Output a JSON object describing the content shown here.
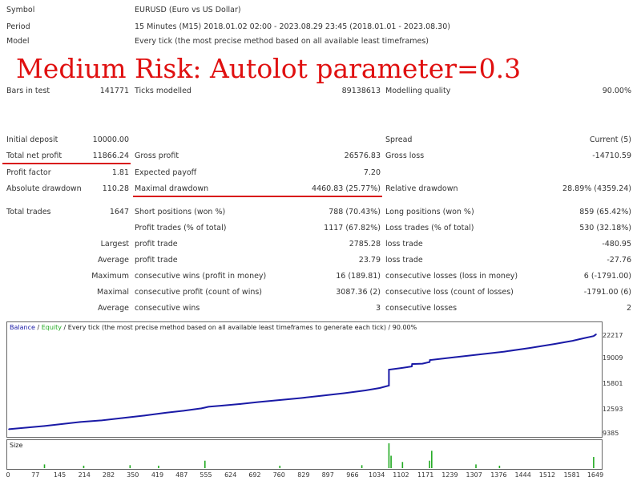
{
  "header": {
    "symbol_label": "Symbol",
    "symbol_value": "EURUSD (Euro vs US Dollar)",
    "period_label": "Period",
    "period_value": "15 Minutes (M15) 2018.01.02 02:00 - 2023.08.29 23:45 (2018.01.01 - 2023.08.30)",
    "model_label": "Model",
    "model_value": "Every tick (the most precise method based on all available least timeframes)"
  },
  "banner": "Medium Risk: Autolot parameter=0.3",
  "bars": {
    "bars_label": "Bars in test",
    "bars_value": "141771",
    "ticks_label": "Ticks modelled",
    "ticks_value": "89138613",
    "quality_label": "Modelling quality",
    "quality_value": "90.00%"
  },
  "stats": {
    "initial_deposit_label": "Initial deposit",
    "initial_deposit_value": "10000.00",
    "spread_label": "Spread",
    "spread_value": "Current (5)",
    "net_profit_label": "Total net profit",
    "net_profit_value": "11866.24",
    "gross_profit_label": "Gross profit",
    "gross_profit_value": "26576.83",
    "gross_loss_label": "Gross loss",
    "gross_loss_value": "-14710.59",
    "profit_factor_label": "Profit factor",
    "profit_factor_value": "1.81",
    "expected_payoff_label": "Expected payoff",
    "expected_payoff_value": "7.20",
    "abs_drawdown_label": "Absolute drawdown",
    "abs_drawdown_value": "110.28",
    "max_drawdown_label": "Maximal drawdown",
    "max_drawdown_value": "4460.83 (25.77%)",
    "rel_drawdown_label": "Relative drawdown",
    "rel_drawdown_value": "28.89% (4359.24)",
    "total_trades_label": "Total trades",
    "total_trades_value": "1647",
    "short_label": "Short positions (won %)",
    "short_value": "788 (70.43%)",
    "long_label": "Long positions (won %)",
    "long_value": "859 (65.42%)",
    "profit_trades_label": "Profit trades (% of total)",
    "profit_trades_value": "1117 (67.82%)",
    "loss_trades_label": "Loss trades (% of total)",
    "loss_trades_value": "530 (32.18%)",
    "largest_label": "Largest",
    "largest_profit_label": "profit trade",
    "largest_profit_value": "2785.28",
    "largest_loss_label": "loss trade",
    "largest_loss_value": "-480.95",
    "average_label": "Average",
    "average_profit_label": "profit trade",
    "average_profit_value": "23.79",
    "average_loss_label": "loss trade",
    "average_loss_value": "-27.76",
    "maximum_label": "Maximum",
    "max_cons_wins_label": "consecutive wins (profit in money)",
    "max_cons_wins_value": "16 (189.81)",
    "max_cons_losses_label": "consecutive losses (loss in money)",
    "max_cons_losses_value": "6 (-1791.00)",
    "maximal_label": "Maximal",
    "maximal_cons_profit_label": "consecutive profit (count of wins)",
    "maximal_cons_profit_value": "3087.36 (2)",
    "maximal_cons_loss_label": "consecutive loss (count of losses)",
    "maximal_cons_loss_value": "-1791.00 (6)",
    "avg2_label": "Average",
    "avg_cons_wins_label": "consecutive wins",
    "avg_cons_wins_value": "3",
    "avg_cons_losses_label": "consecutive losses",
    "avg_cons_losses_value": "2"
  },
  "chart_caption": {
    "balance": "Balance",
    "slash": " / ",
    "equity": "Equity",
    "rest": " / Every tick (the most precise method based on all available least timeframes to generate each tick) / 90.00%"
  },
  "colors": {
    "balance": "#1a1aa6",
    "equity": "#22aa22",
    "underline": "#d91a1a",
    "banner": "#e01010"
  },
  "chart_data": {
    "type": "line",
    "title": "",
    "y_ticks": [
      22217,
      19009,
      15801,
      12593,
      9385
    ],
    "ylim": [
      9385,
      22217
    ],
    "xlim": [
      0,
      1647
    ],
    "x_ticks": [
      0,
      77,
      145,
      214,
      282,
      350,
      419,
      487,
      555,
      624,
      692,
      760,
      829,
      897,
      966,
      1034,
      1102,
      1171,
      1239,
      1307,
      1376,
      1444,
      1512,
      1581,
      1649
    ],
    "series": [
      {
        "name": "Balance",
        "x": [
          0,
          50,
          100,
          150,
          200,
          260,
          320,
          380,
          440,
          490,
          540,
          560,
          600,
          650,
          700,
          760,
          820,
          880,
          940,
          1000,
          1040,
          1066,
          1066,
          1100,
          1130,
          1131,
          1160,
          1180,
          1181,
          1250,
          1320,
          1390,
          1460,
          1530,
          1581,
          1600,
          1640,
          1647
        ],
        "y": [
          10050,
          10250,
          10450,
          10700,
          10950,
          11150,
          11450,
          11750,
          12100,
          12350,
          12650,
          12850,
          13000,
          13200,
          13450,
          13700,
          13950,
          14250,
          14550,
          14900,
          15200,
          15500,
          17500,
          17700,
          17900,
          18200,
          18250,
          18450,
          18700,
          19050,
          19400,
          19750,
          20200,
          20700,
          21100,
          21300,
          21700,
          21916
        ]
      }
    ],
    "volume": {
      "name": "Size",
      "x": [
        100,
        210,
        340,
        420,
        550,
        760,
        990,
        1066,
        1072,
        1104,
        1180,
        1186,
        1310,
        1376,
        1640
      ],
      "v": [
        0.15,
        0.1,
        0.12,
        0.1,
        0.3,
        0.1,
        0.12,
        1.0,
        0.5,
        0.25,
        0.3,
        0.7,
        0.15,
        0.1,
        0.45
      ]
    }
  }
}
